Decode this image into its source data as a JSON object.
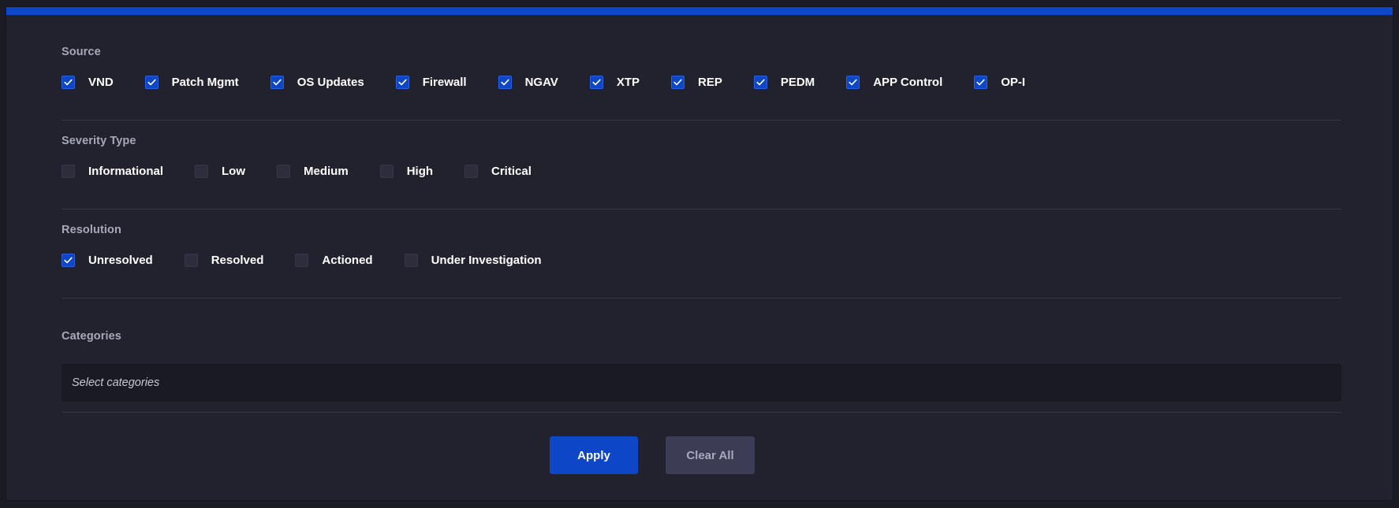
{
  "accent_color": "#0d47c7",
  "sections": {
    "source": {
      "title": "Source",
      "options": [
        {
          "label": "VND",
          "checked": true
        },
        {
          "label": "Patch Mgmt",
          "checked": true
        },
        {
          "label": "OS Updates",
          "checked": true
        },
        {
          "label": "Firewall",
          "checked": true
        },
        {
          "label": "NGAV",
          "checked": true
        },
        {
          "label": "XTP",
          "checked": true
        },
        {
          "label": "REP",
          "checked": true
        },
        {
          "label": "PEDM",
          "checked": true
        },
        {
          "label": "APP Control",
          "checked": true
        },
        {
          "label": "OP-I",
          "checked": true
        }
      ]
    },
    "severity": {
      "title": "Severity Type",
      "options": [
        {
          "label": "Informational",
          "checked": false
        },
        {
          "label": "Low",
          "checked": false
        },
        {
          "label": "Medium",
          "checked": false
        },
        {
          "label": "High",
          "checked": false
        },
        {
          "label": "Critical",
          "checked": false
        }
      ]
    },
    "resolution": {
      "title": "Resolution",
      "options": [
        {
          "label": "Unresolved",
          "checked": true
        },
        {
          "label": "Resolved",
          "checked": false
        },
        {
          "label": "Actioned",
          "checked": false
        },
        {
          "label": "Under Investigation",
          "checked": false
        }
      ]
    },
    "categories": {
      "title": "Categories",
      "placeholder": "Select categories",
      "value": ""
    }
  },
  "actions": {
    "apply_label": "Apply",
    "clear_label": "Clear All"
  },
  "icons": {
    "checked": "check-icon"
  }
}
